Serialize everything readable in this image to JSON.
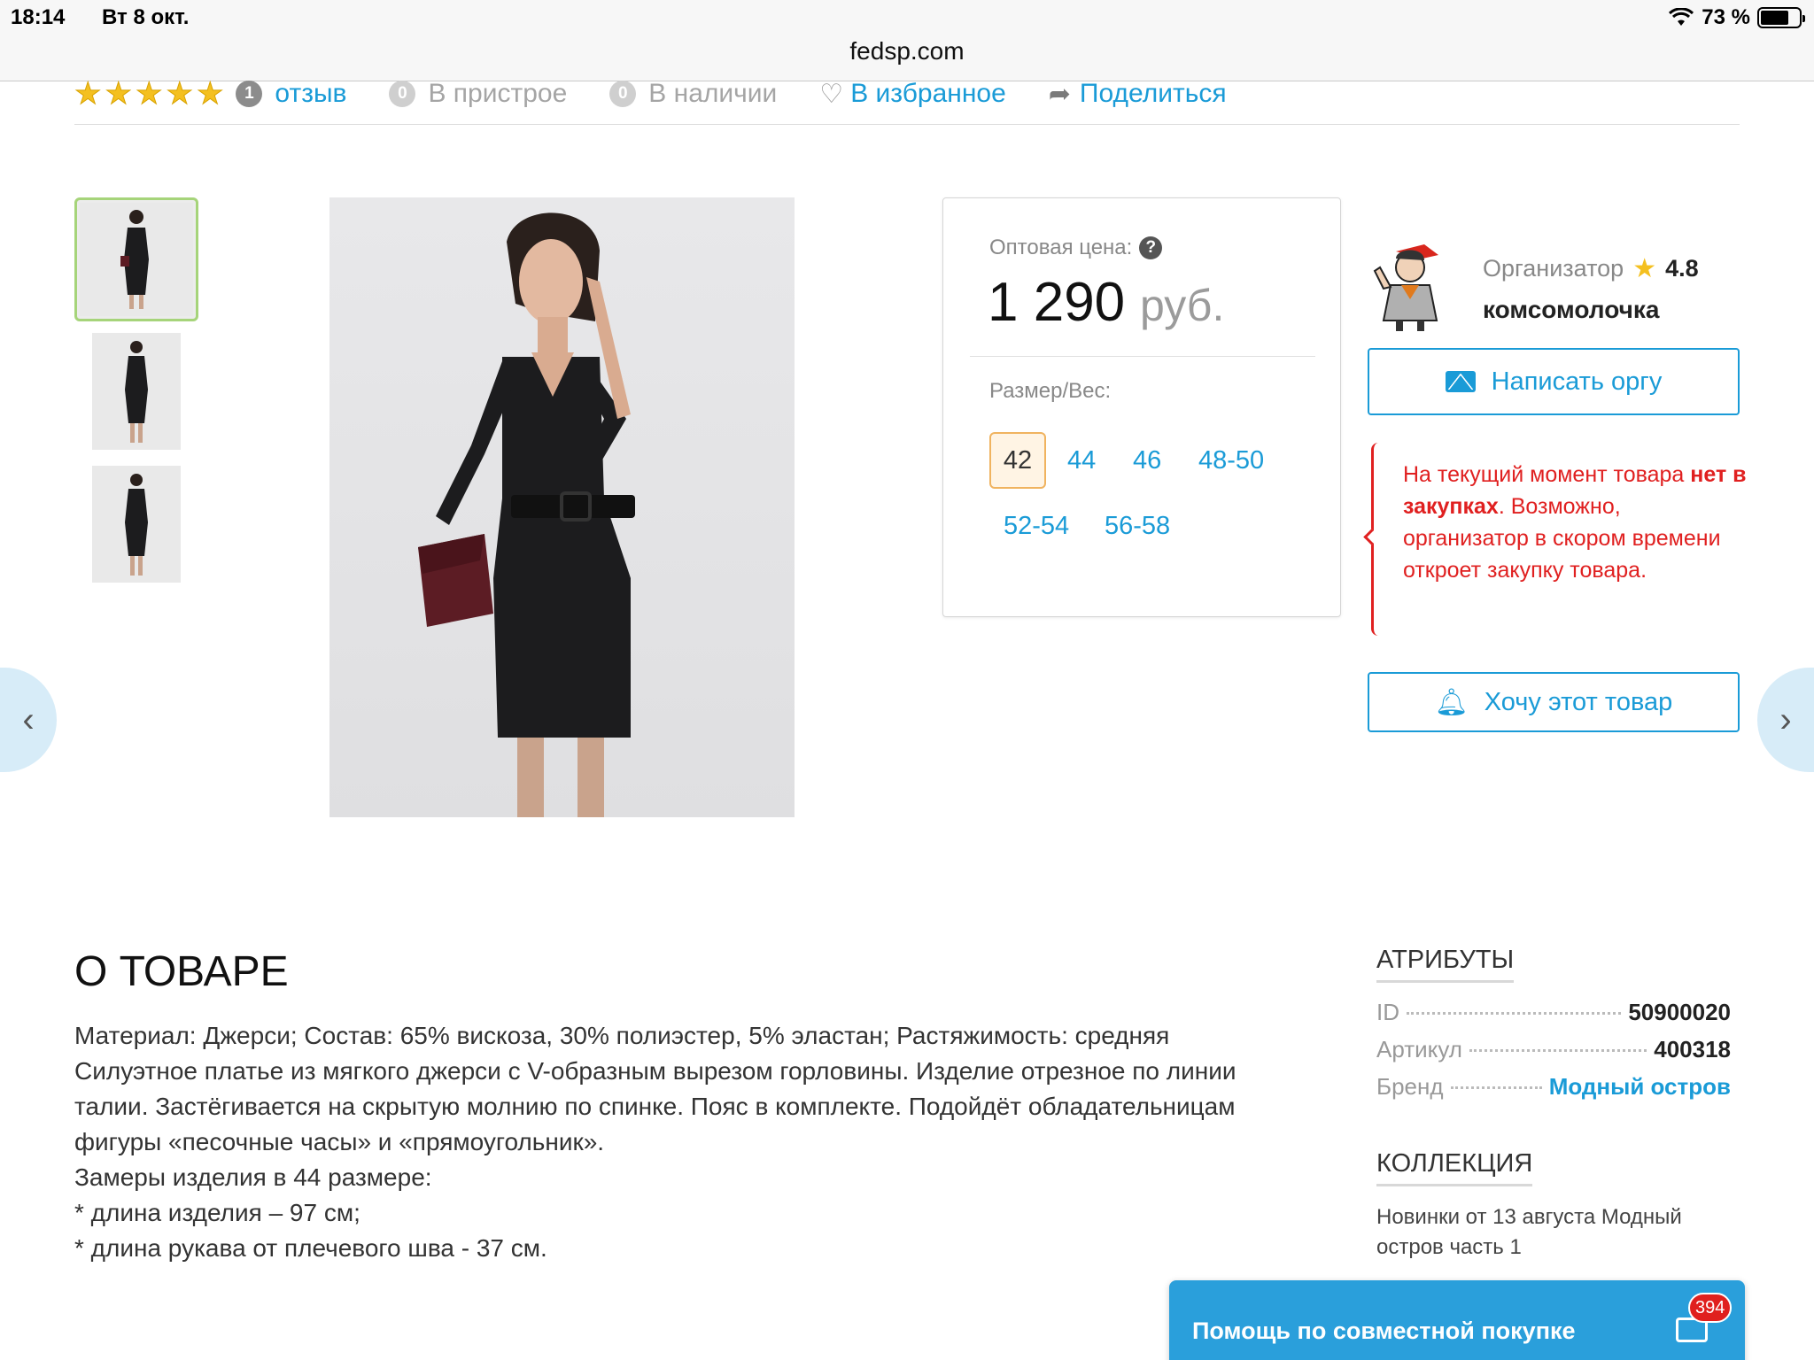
{
  "status_bar": {
    "time": "18:14",
    "date": "Вт 8 окт.",
    "battery": "73 %",
    "battery_level": 0.73
  },
  "browser": {
    "url": "fedsp.com"
  },
  "rating_row": {
    "stars": 5,
    "review_count": "1",
    "review_label": "отзыв",
    "fitting_count": "0",
    "fitting_label": "В пристрое",
    "stock_count": "0",
    "stock_label": "В наличии",
    "favorite_label": "В избранное",
    "share_label": "Поделиться"
  },
  "gallery": {
    "thumbnails": 3,
    "active_thumbnail": 0
  },
  "price": {
    "label": "Оптовая цена:",
    "amount": "1 290",
    "currency": "руб.",
    "size_label": "Размер/Вес:",
    "sizes": [
      "42",
      "44",
      "46",
      "48-50",
      "52-54",
      "56-58"
    ],
    "selected_size": "42"
  },
  "organizer": {
    "label": "Организатор",
    "rating": "4.8",
    "name": "комсомолочка",
    "write_button": "Написать оргу",
    "notice_part1": "На текущий момент товара ",
    "notice_bold": "нет в закупках",
    "notice_part2": ". Возможно, организатор в скором времени откроет закупку товара.",
    "want_button": "Хочу этот товар"
  },
  "about": {
    "title": "О ТОВАРЕ",
    "lines": [
      "Материал: Джерси; Состав: 65% вискоза, 30% полиэстер, 5% эластан; Растяжимость: средняя",
      "Силуэтное платье из мягкого джерси с V-образным вырезом горловины. Изделие отрезное по линии талии. Застёгивается на скрытую молнию по спинке. Пояс в комплекте. Подойдёт обладательницам фигуры «песочные часы» и «прямоугольник».",
      "Замеры изделия в 44 размере:",
      "* длина изделия – 97 см;",
      "* длина рукава от плечевого шва - 37 см."
    ]
  },
  "attributes": {
    "title": "АТРИБУТЫ",
    "items": [
      {
        "key": "ID",
        "value": "50900020"
      },
      {
        "key": "Артикул",
        "value": "400318"
      },
      {
        "key": "Бренд",
        "value": "Модный остров"
      }
    ]
  },
  "collection": {
    "title": "КОЛЛЕКЦИЯ",
    "text": "Новинки от 13 августа Модный остров часть 1"
  },
  "help": {
    "label": "Помощь по совместной покупке",
    "badge": "394"
  },
  "colors": {
    "link": "#1a9bd7",
    "alert": "#e02020",
    "help_bg": "#2a9fdb",
    "size_selected_border": "#f0b35f",
    "thumb_active_border": "#a6d47a"
  }
}
